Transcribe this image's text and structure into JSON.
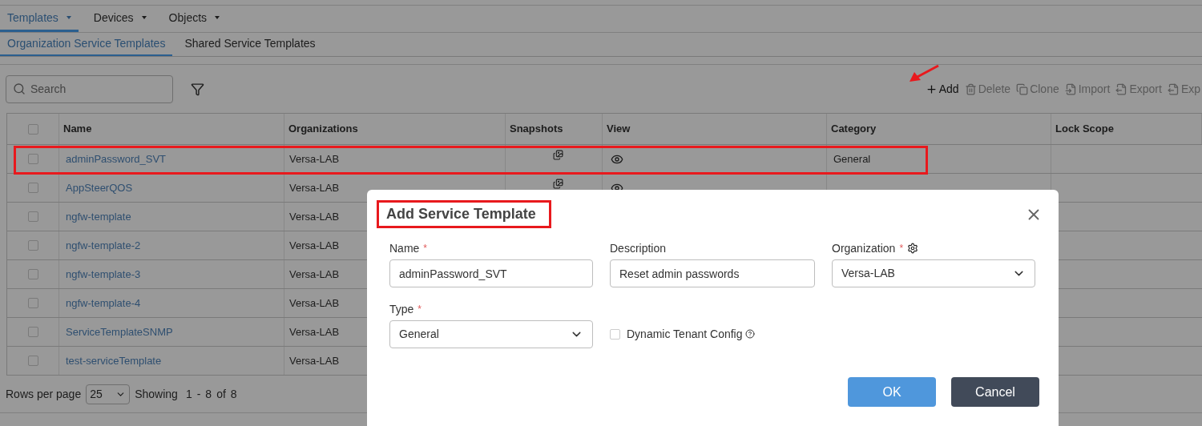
{
  "nav_tabs": [
    {
      "label": "Templates",
      "selected": true
    },
    {
      "label": "Devices",
      "selected": false
    },
    {
      "label": "Objects",
      "selected": false
    }
  ],
  "sub_tabs": [
    {
      "label": "Organization Service Templates",
      "selected": true
    },
    {
      "label": "Shared Service Templates",
      "selected": false
    }
  ],
  "search": {
    "placeholder": "Search"
  },
  "actions": [
    {
      "label": "Add",
      "kind": "add",
      "disabled": false
    },
    {
      "label": "Delete",
      "kind": "delete",
      "disabled": true
    },
    {
      "label": "Clone",
      "kind": "clone",
      "disabled": true
    },
    {
      "label": "Import",
      "kind": "import",
      "disabled": true
    },
    {
      "label": "Export",
      "kind": "export",
      "disabled": true
    },
    {
      "label": "Exp",
      "kind": "export",
      "disabled": true
    }
  ],
  "table": {
    "columns": [
      "Name",
      "Organizations",
      "Snapshots",
      "View",
      "Category",
      "Lock Scope"
    ],
    "all_checked": false,
    "rows": [
      {
        "name": "adminPassword_SVT",
        "organization": "Versa-LAB",
        "category": "General",
        "has_snapshot": true,
        "checked": false
      },
      {
        "name": "AppSteerQOS",
        "organization": "Versa-LAB",
        "has_snapshot": true,
        "checked": false
      },
      {
        "name": "ngfw-template",
        "organization": "Versa-LAB",
        "checked": false
      },
      {
        "name": "ngfw-template-2",
        "organization": "Versa-LAB",
        "checked": false
      },
      {
        "name": "ngfw-template-3",
        "organization": "Versa-LAB",
        "checked": false
      },
      {
        "name": "ngfw-template-4",
        "organization": "Versa-LAB",
        "checked": false
      },
      {
        "name": "ServiceTemplateSNMP",
        "organization": "Versa-LAB",
        "checked": false
      },
      {
        "name": "test-serviceTemplate",
        "organization": "Versa-LAB",
        "checked": false
      }
    ]
  },
  "pagination": {
    "rows_label": "Rows per page",
    "rows_value": "25",
    "showing": "Showing",
    "from": "1",
    "dash": "-",
    "to": "8",
    "of": "of",
    "total": "8"
  },
  "dialog": {
    "title": "Add Service Template",
    "fields": [
      {
        "label": "Name",
        "required_mark": "*",
        "kind": "text",
        "value": "adminPassword_SVT"
      },
      {
        "label": "Description",
        "kind": "text",
        "value": "Reset admin passwords"
      },
      {
        "label": "Organization",
        "required_mark": "*",
        "kind": "select",
        "value": "Versa-LAB",
        "has_settings": true
      },
      {
        "label": "Type",
        "required_mark": "*",
        "kind": "select",
        "value": "General"
      }
    ],
    "checkbox": {
      "label": "Dynamic Tenant Config",
      "checked": false
    },
    "buttons": [
      {
        "label": "OK",
        "kind": "primary"
      },
      {
        "label": "Cancel",
        "kind": "secondary"
      }
    ]
  }
}
